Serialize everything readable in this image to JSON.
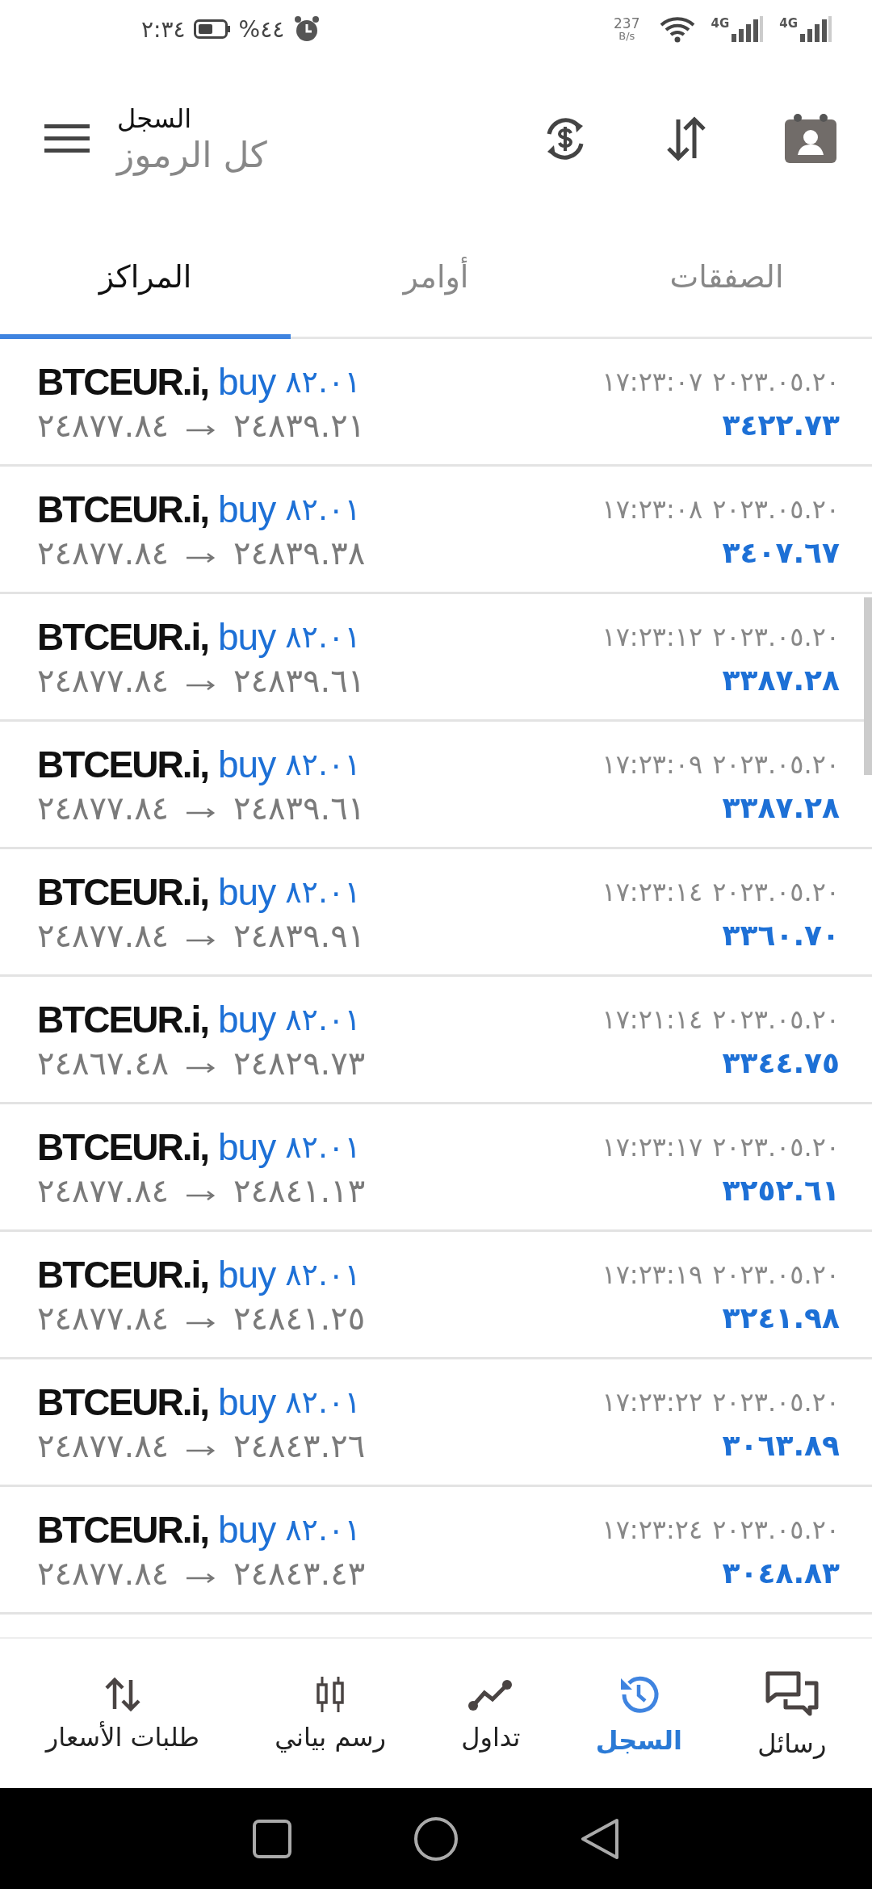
{
  "status_bar": {
    "time": "٢:٣٤",
    "battery": "%٤٤",
    "speed": "237",
    "speed_unit": "B/s",
    "network_1": "4G",
    "network_2": "4G"
  },
  "header": {
    "title": "السجل",
    "subtitle": "كل الرموز"
  },
  "tabs": [
    {
      "label": "الصفقات",
      "selected": false
    },
    {
      "label": "أوامر",
      "selected": false
    },
    {
      "label": "المراكز",
      "selected": true
    }
  ],
  "positions": [
    {
      "symbol": "BTCEUR.i,",
      "type": "buy",
      "volume": "٨٢.٠١",
      "open_price": "٢٤٨٧٧.٨٤",
      "close_price": "٢٤٨٣٩.٢١",
      "date": "٢٠٢٣.٠٥.٢٠",
      "time": "١٧:٢٣:٠٧",
      "profit": "٣٤٢٢.٧٣"
    },
    {
      "symbol": "BTCEUR.i,",
      "type": "buy",
      "volume": "٨٢.٠١",
      "open_price": "٢٤٨٧٧.٨٤",
      "close_price": "٢٤٨٣٩.٣٨",
      "date": "٢٠٢٣.٠٥.٢٠",
      "time": "١٧:٢٣:٠٨",
      "profit": "٣٤٠٧.٦٧"
    },
    {
      "symbol": "BTCEUR.i,",
      "type": "buy",
      "volume": "٨٢.٠١",
      "open_price": "٢٤٨٧٧.٨٤",
      "close_price": "٢٤٨٣٩.٦١",
      "date": "٢٠٢٣.٠٥.٢٠",
      "time": "١٧:٢٣:١٢",
      "profit": "٣٣٨٧.٢٨"
    },
    {
      "symbol": "BTCEUR.i,",
      "type": "buy",
      "volume": "٨٢.٠١",
      "open_price": "٢٤٨٧٧.٨٤",
      "close_price": "٢٤٨٣٩.٦١",
      "date": "٢٠٢٣.٠٥.٢٠",
      "time": "١٧:٢٣:٠٩",
      "profit": "٣٣٨٧.٢٨"
    },
    {
      "symbol": "BTCEUR.i,",
      "type": "buy",
      "volume": "٨٢.٠١",
      "open_price": "٢٤٨٧٧.٨٤",
      "close_price": "٢٤٨٣٩.٩١",
      "date": "٢٠٢٣.٠٥.٢٠",
      "time": "١٧:٢٣:١٤",
      "profit": "٣٣٦٠.٧٠"
    },
    {
      "symbol": "BTCEUR.i,",
      "type": "buy",
      "volume": "٨٢.٠١",
      "open_price": "٢٤٨٦٧.٤٨",
      "close_price": "٢٤٨٢٩.٧٣",
      "date": "٢٠٢٣.٠٥.٢٠",
      "time": "١٧:٢١:١٤",
      "profit": "٣٣٤٤.٧٥"
    },
    {
      "symbol": "BTCEUR.i,",
      "type": "buy",
      "volume": "٨٢.٠١",
      "open_price": "٢٤٨٧٧.٨٤",
      "close_price": "٢٤٨٤١.١٣",
      "date": "٢٠٢٣.٠٥.٢٠",
      "time": "١٧:٢٣:١٧",
      "profit": "٣٢٥٢.٦١"
    },
    {
      "symbol": "BTCEUR.i,",
      "type": "buy",
      "volume": "٨٢.٠١",
      "open_price": "٢٤٨٧٧.٨٤",
      "close_price": "٢٤٨٤١.٢٥",
      "date": "٢٠٢٣.٠٥.٢٠",
      "time": "١٧:٢٣:١٩",
      "profit": "٣٢٤١.٩٨"
    },
    {
      "symbol": "BTCEUR.i,",
      "type": "buy",
      "volume": "٨٢.٠١",
      "open_price": "٢٤٨٧٧.٨٤",
      "close_price": "٢٤٨٤٣.٢٦",
      "date": "٢٠٢٣.٠٥.٢٠",
      "time": "١٧:٢٣:٢٢",
      "profit": "٣٠٦٣.٨٩"
    },
    {
      "symbol": "BTCEUR.i,",
      "type": "buy",
      "volume": "٨٢.٠١",
      "open_price": "٢٤٨٧٧.٨٤",
      "close_price": "٢٤٨٤٣.٤٣",
      "date": "٢٠٢٣.٠٥.٢٠",
      "time": "١٧:٢٣:٢٤",
      "profit": "٣٠٤٨.٨٣"
    }
  ],
  "bottom_nav": [
    {
      "label": "رسائل",
      "kind": "messages",
      "selected": false
    },
    {
      "label": "السجل",
      "kind": "history",
      "selected": true
    },
    {
      "label": "تداول",
      "kind": "trade",
      "selected": false
    },
    {
      "label": "رسم بياني",
      "kind": "chart",
      "selected": false
    },
    {
      "label": "طلبات الأسعار",
      "kind": "quotes",
      "selected": false
    }
  ]
}
